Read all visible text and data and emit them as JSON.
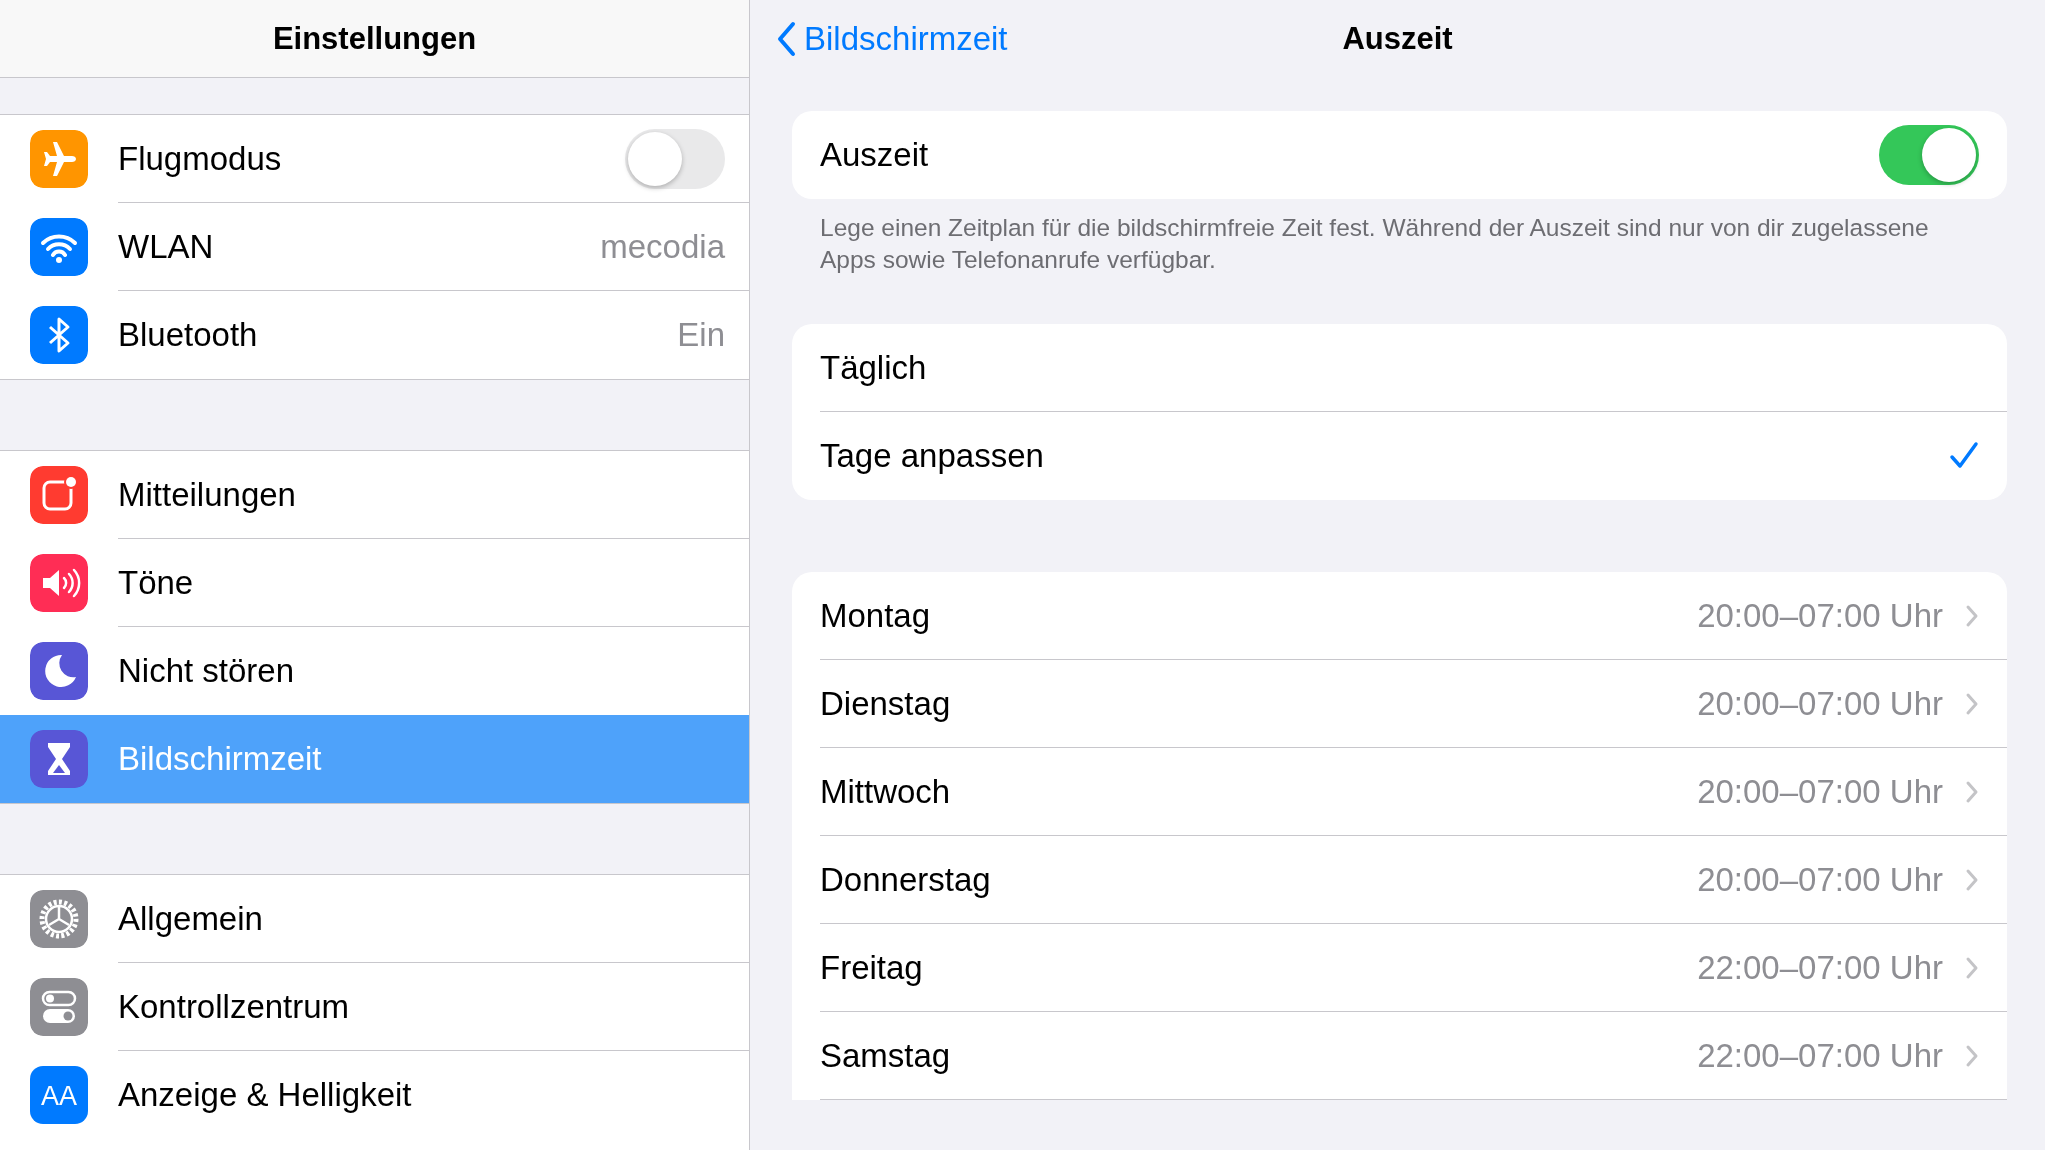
{
  "sidebar": {
    "title": "Einstellungen",
    "groups": [
      [
        {
          "label": "Flugmodus",
          "kind": "toggle",
          "on": false,
          "selected": false
        },
        {
          "label": "WLAN",
          "kind": "value",
          "value": "mecodia",
          "selected": false
        },
        {
          "label": "Bluetooth",
          "kind": "value",
          "value": "Ein",
          "selected": false
        }
      ],
      [
        {
          "label": "Mitteilungen",
          "kind": "plain",
          "selected": false
        },
        {
          "label": "Töne",
          "kind": "plain",
          "selected": false
        },
        {
          "label": "Nicht stören",
          "kind": "plain",
          "selected": false
        },
        {
          "label": "Bildschirmzeit",
          "kind": "plain",
          "selected": true
        }
      ],
      [
        {
          "label": "Allgemein",
          "kind": "plain",
          "selected": false
        },
        {
          "label": "Kontrollzentrum",
          "kind": "plain",
          "selected": false
        },
        {
          "label": "Anzeige & Helligkeit",
          "kind": "plain",
          "selected": false,
          "icon_text": "AA"
        }
      ]
    ]
  },
  "detail": {
    "back": "Bildschirmzeit",
    "title": "Auszeit",
    "toggle": {
      "label": "Auszeit",
      "on": true
    },
    "footer": "Lege einen Zeitplan für die bildschirmfreie Zeit fest. Während der Auszeit sind nur von dir zugelassene Apps sowie Telefonanrufe verfügbar.",
    "modes": [
      {
        "label": "Täglich",
        "selected": false
      },
      {
        "label": "Tage anpassen",
        "selected": true
      }
    ],
    "days": [
      {
        "label": "Montag",
        "value": "20:00–07:00 Uhr"
      },
      {
        "label": "Dienstag",
        "value": "20:00–07:00 Uhr"
      },
      {
        "label": "Mittwoch",
        "value": "20:00–07:00 Uhr"
      },
      {
        "label": "Donnerstag",
        "value": "20:00–07:00 Uhr"
      },
      {
        "label": "Freitag",
        "value": "22:00–07:00 Uhr"
      },
      {
        "label": "Samstag",
        "value": "22:00–07:00 Uhr"
      }
    ]
  }
}
